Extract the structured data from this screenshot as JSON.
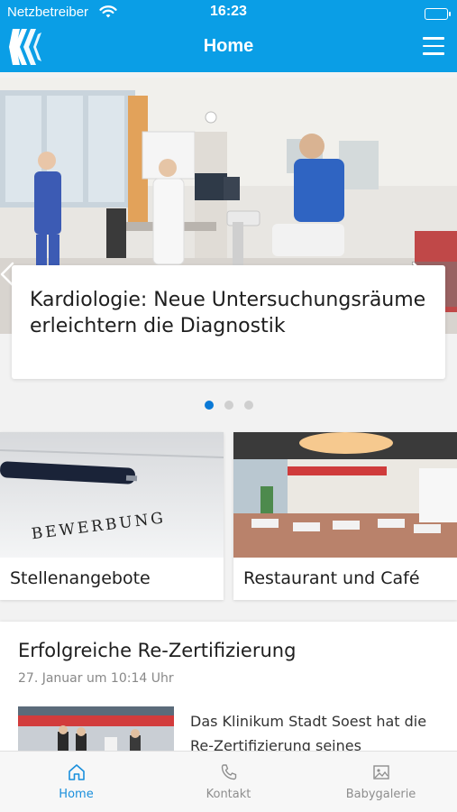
{
  "status_bar": {
    "carrier": "Netzbetreiber",
    "time": "16:23",
    "wifi_icon": "wifi-icon",
    "battery_level": 1.0
  },
  "app_bar": {
    "title": "Home",
    "logo_icon": "klinikum-logo-icon",
    "menu_icon": "hamburger-menu-icon"
  },
  "hero": {
    "headline": "Kardiologie: Neue Untersuchungsräume erleichtern die Diagnostik",
    "prev_icon": "chevron-left-icon",
    "next_icon": "chevron-right-icon",
    "slide_count": 3,
    "active_slide": 1
  },
  "tiles": [
    {
      "label": "Stellenangebote",
      "image_text": "BEWERBUNG"
    },
    {
      "label": "Restaurant und Café"
    }
  ],
  "news": {
    "title": "Erfolgreiche Re-Zertifizierung",
    "date": "27. Januar um 10:14 Uhr",
    "excerpt": "Das Klinikum Stadt Soest hat die Re-Zertifizierung seines"
  },
  "tab_bar": {
    "tabs": [
      {
        "label": "Home",
        "icon": "home-icon",
        "active": true
      },
      {
        "label": "Kontakt",
        "icon": "phone-icon",
        "active": false
      },
      {
        "label": "Babygalerie",
        "icon": "gallery-icon",
        "active": false
      }
    ]
  },
  "colors": {
    "brand_blue": "#0a9ee6",
    "active_tab": "#1a8fdc",
    "active_dot": "#0a79d6"
  }
}
